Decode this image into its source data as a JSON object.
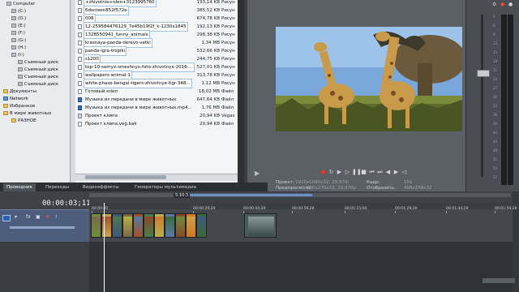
{
  "explorer": {
    "tree": [
      {
        "label": "Computer",
        "icon": "computer-icon"
      },
      {
        "label": "(C:)",
        "icon": "drive-icon"
      },
      {
        "label": "(D:)",
        "icon": "drive-icon"
      },
      {
        "label": "(E:)",
        "icon": "drive-icon"
      },
      {
        "label": "(F:)",
        "icon": "drive-icon"
      },
      {
        "label": "(G:)",
        "icon": "drive-icon"
      },
      {
        "label": "(H:)",
        "icon": "drive-icon"
      },
      {
        "label": "(I:)",
        "icon": "drive-icon"
      },
      {
        "label": "Съемный диск",
        "icon": "removable-drive-icon"
      },
      {
        "label": "Съемный диск",
        "icon": "removable-drive-icon"
      },
      {
        "label": "Съемный диск",
        "icon": "removable-drive-icon"
      },
      {
        "label": "Съемный диск",
        "icon": "removable-drive-icon"
      },
      {
        "label": "Документы",
        "icon": "folder-icon"
      },
      {
        "label": "Network",
        "icon": "network-icon"
      },
      {
        "label": "Избранное",
        "icon": "folder-icon"
      },
      {
        "label": "В мире животных",
        "icon": "folder-icon"
      },
      {
        "label": "РАЗНОЕ",
        "icon": "folder-icon"
      }
    ],
    "files": [
      {
        "name": "+zhivotnie+olen+3123995760",
        "size": "193,14 KB",
        "type": "Рисун",
        "kind": "image",
        "selected": true
      },
      {
        "name": "6dscreen852f572e",
        "size": "385,52 KB",
        "type": "Рисун",
        "kind": "image",
        "selected": true
      },
      {
        "name": "008",
        "size": "674,78 KB",
        "type": "Рисун",
        "kind": "image",
        "selected": true
      },
      {
        "name": "12-2595844761​29_7e45b19f2f_k-1230x1845",
        "size": "192,13 KB",
        "type": "Рисун",
        "kind": "image",
        "selected": true
      },
      {
        "name": "1328550941_funny_animals",
        "size": "298,38 KB",
        "type": "Рисун",
        "kind": "image",
        "selected": true
      },
      {
        "name": "krasnaya-panda-derevo-vetki",
        "size": "1,34 MB",
        "type": "Рисун",
        "kind": "image",
        "selected": true
      },
      {
        "name": "panda-igra-tropiki",
        "size": "532,66 KB",
        "type": "Рисун",
        "kind": "image",
        "selected": true
      },
      {
        "name": "s1200",
        "size": "244,75 KB",
        "type": "Рисун",
        "kind": "image",
        "selected": true
      },
      {
        "name": "top-10-samyx-smeshnyx-foto-zhivotnyx-2016-...",
        "size": "527,01 KB",
        "type": "Рисун",
        "kind": "image",
        "selected": true
      },
      {
        "name": "wallpapers-animal-1",
        "size": "313,78 KB",
        "type": "Рисун",
        "kind": "image",
        "selected": true
      },
      {
        "name": "white-phase-bengal-tigers-zhivotnye-tigr-348...",
        "size": "1,12 MB",
        "type": "Рисун",
        "kind": "image",
        "selected": true
      },
      {
        "name": "Готовый клип",
        "size": "18,02 MB",
        "type": "Файл",
        "kind": "video",
        "selected": false
      },
      {
        "name": "Музыка из передачи в мире животных",
        "size": "647,64 KB",
        "type": "Файл",
        "kind": "audio",
        "selected": false
      },
      {
        "name": "Музыка из передачи в мире животных.mp4...",
        "size": "1,76 MB",
        "type": "Файл",
        "kind": "audio",
        "selected": false
      },
      {
        "name": "Проект клипа",
        "size": "20,94 KB",
        "type": "Vegas",
        "kind": "project",
        "selected": false
      },
      {
        "name": "Проект клипа.veg.bak",
        "size": "20,94 KB",
        "type": "Файл",
        "kind": "file",
        "selected": false
      }
    ]
  },
  "tabs": [
    {
      "label": "Проводник",
      "active": true
    },
    {
      "label": "Переходы",
      "active": false
    },
    {
      "label": "Видеоэффекты",
      "active": false
    },
    {
      "label": "Генераторы мультимедиа",
      "active": false
    }
  ],
  "preview": {
    "info": {
      "project_label": "Проект:",
      "project_value": "1920x1080x32; 29,970i",
      "preview_label": "Предпросмотр:",
      "preview_value": "480x270x32; 29,970p",
      "frame_label": "Кадр:",
      "frame_value": "101",
      "display_label": "Отобразить:",
      "display_value": "498x258x32"
    }
  },
  "timeline": {
    "time": "00:00:03;11",
    "region_label": "5:10:3",
    "ruler": [
      "00:00:00",
      "00:00:29;29",
      "00:00:44;29",
      "00:00:59;28",
      "00:01:15;00",
      "00:01:29;29",
      "00:01:44;29",
      "00:01:59;28"
    ]
  },
  "mixer": {
    "scale": [
      "3",
      "6",
      "9",
      "12",
      "15",
      "18",
      "21",
      "24",
      "27",
      "30",
      "33",
      "36",
      "39",
      "42",
      "45",
      "48",
      "51",
      "54",
      "57"
    ]
  }
}
